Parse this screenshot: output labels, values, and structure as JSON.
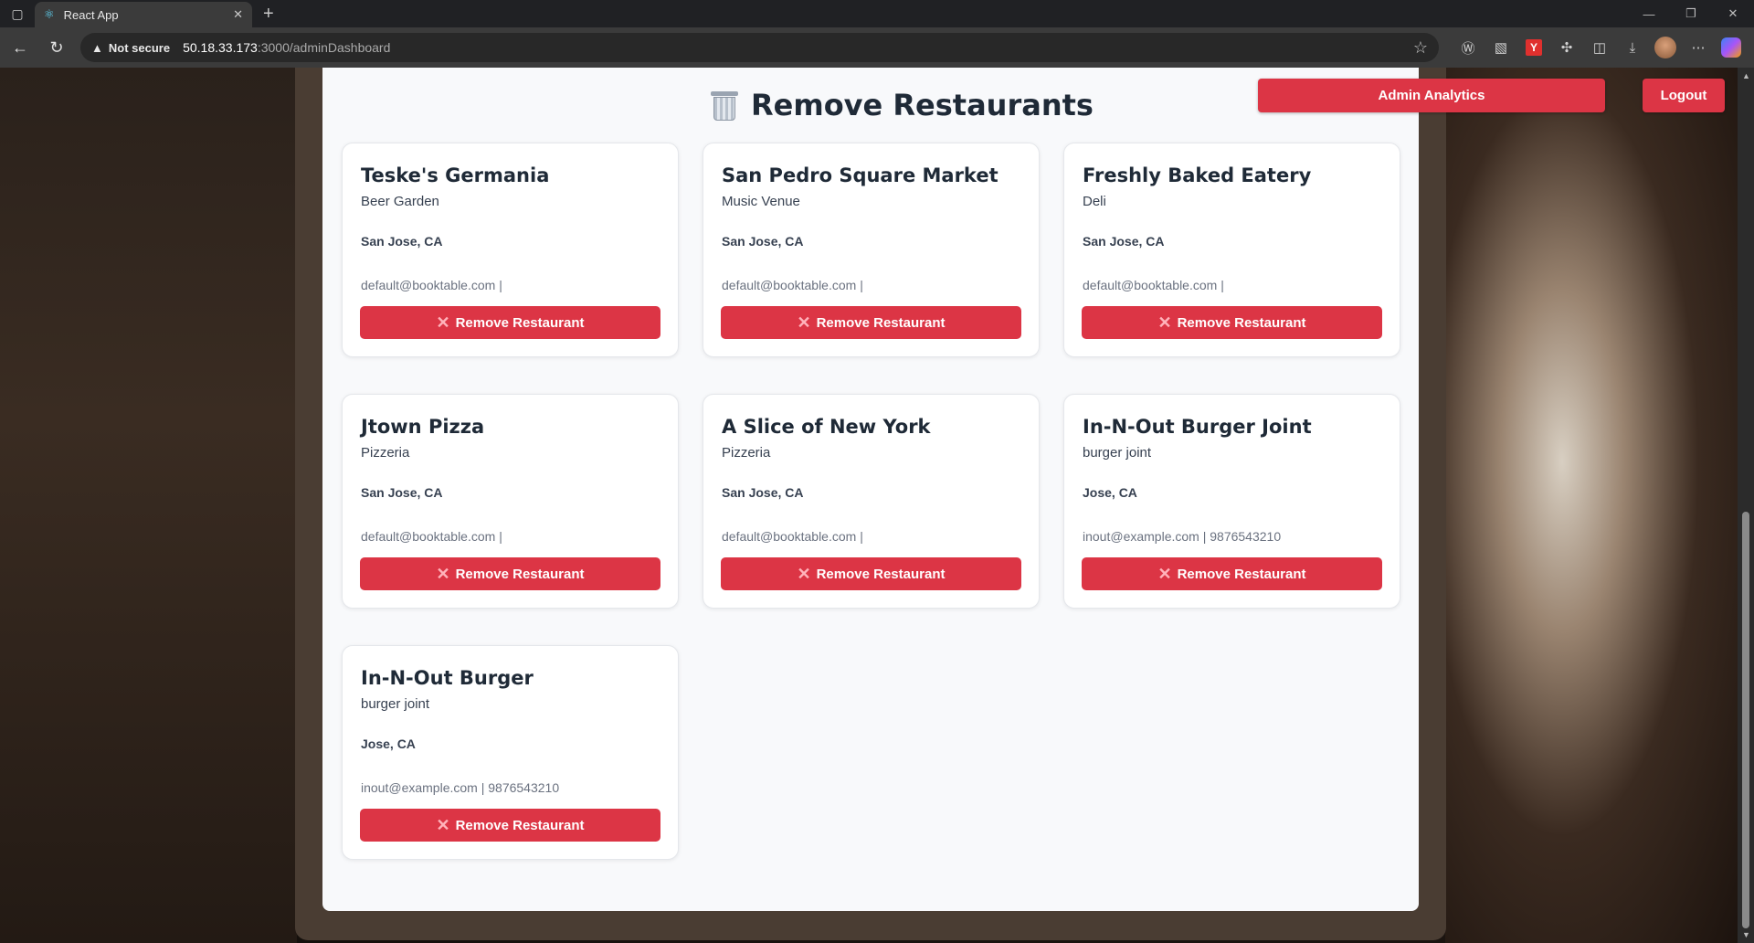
{
  "browser": {
    "tab_title": "React App",
    "not_secure_label": "Not secure",
    "url_host": "50.18.33.173",
    "url_path": ":3000/adminDashboard"
  },
  "page": {
    "title": "Remove Restaurants",
    "analytics_label": "Admin Analytics",
    "logout_label": "Logout",
    "remove_label": "Remove Restaurant"
  },
  "restaurants": [
    {
      "name": "Teske's Germania",
      "category": "Beer Garden",
      "location": "San Jose, CA",
      "contact": "default@booktable.com |"
    },
    {
      "name": "San Pedro Square Market",
      "category": "Music Venue",
      "location": "San Jose, CA",
      "contact": "default@booktable.com |"
    },
    {
      "name": "Freshly Baked Eatery",
      "category": "Deli",
      "location": "San Jose, CA",
      "contact": "default@booktable.com |"
    },
    {
      "name": "Jtown Pizza",
      "category": "Pizzeria",
      "location": "San Jose, CA",
      "contact": "default@booktable.com |"
    },
    {
      "name": "A Slice of New York",
      "category": "Pizzeria",
      "location": "San Jose, CA",
      "contact": "default@booktable.com |"
    },
    {
      "name": "In-N-Out Burger Joint",
      "category": "burger joint",
      "location": "Jose, CA",
      "contact": "inout@example.com | 9876543210"
    },
    {
      "name": "In-N-Out Burger",
      "category": "burger joint",
      "location": "Jose, CA",
      "contact": "inout@example.com | 9876543210"
    }
  ],
  "colors": {
    "accent": "#dc3545",
    "title": "#1f2a37",
    "panel": "#f8f9fb"
  }
}
